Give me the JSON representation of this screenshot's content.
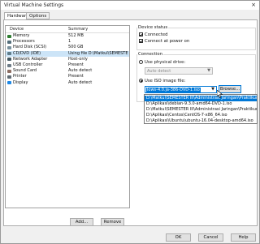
{
  "window": {
    "title": "Virtual Machine Settings",
    "close_glyph": "×"
  },
  "tabs": [
    "Hardware",
    "Options"
  ],
  "devices": {
    "headers": [
      "Device",
      "Summary"
    ],
    "rows": [
      {
        "name": "Memory",
        "summary": "512 MB",
        "icon": "memory-icon",
        "color": "#2f7d32"
      },
      {
        "name": "Processors",
        "summary": "1",
        "icon": "processor-icon",
        "color": "#546e7a"
      },
      {
        "name": "Hard Disk (SCSI)",
        "summary": "500 GB",
        "icon": "hard-disk-icon",
        "color": "#78909c"
      },
      {
        "name": "CD/DVD (IDE)",
        "summary": "Using file D:\\Matkul\\SEMESTER ...",
        "icon": "cd-dvd-icon",
        "color": "#607d8b"
      },
      {
        "name": "Network Adapter",
        "summary": "Host-only",
        "icon": "network-adapter-icon",
        "color": "#455a64"
      },
      {
        "name": "USB Controller",
        "summary": "Present",
        "icon": "usb-controller-icon",
        "color": "#6d7b86"
      },
      {
        "name": "Sound Card",
        "summary": "Auto detect",
        "icon": "sound-card-icon",
        "color": "#8d6e63"
      },
      {
        "name": "Printer",
        "summary": "Present",
        "icon": "printer-icon",
        "color": "#5f6b73"
      },
      {
        "name": "Display",
        "summary": "Auto detect",
        "icon": "display-icon",
        "color": "#1e88e5"
      }
    ],
    "selected_index": 3
  },
  "buttons": {
    "add": "Add...",
    "remove": "Remove",
    "browse": "Browse...",
    "ok": "OK",
    "cancel": "Cancel",
    "help": "Help"
  },
  "device_status": {
    "legend": "Device status",
    "connected": "Connected",
    "connect_at_power_on": "Connect at power on"
  },
  "connection": {
    "legend": "Connection",
    "physical_label": "Use physical drive:",
    "physical_value": "Auto detect",
    "iso_label": "Use ISO image file:",
    "iso_value": "lows-4.0.ja-386-DVD-1.iso",
    "iso_options": [
      "D:\\Matkul\\SEMESTER III\\Administrasi Jaringan\\Praktikum\\OS - C",
      "D:\\Aplikasi\\debian-9.3.0-amd64-DVD-1.iso",
      "D:\\Matkul\\SEMESTER III\\Administrasi Jaringan\\Praktikum\\OS - C",
      "D:\\Aplikasi\\Centos\\CentOS-7-x86_64.iso",
      "D:\\Aplikasi\\Ubuntu\\ubuntu-16.04-desktop-amd64.iso"
    ]
  },
  "colors": {
    "accent": "#0078d7",
    "selection": "#cce4f7"
  }
}
